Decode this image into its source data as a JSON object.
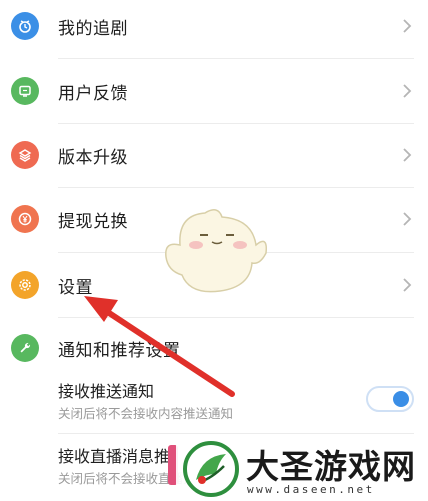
{
  "colors": {
    "blue": "#3b8fe6",
    "green": "#58b85f",
    "red": "#ef6a52",
    "coral": "#f0744f",
    "orange": "#f3a42a",
    "arrow": "#e0302a",
    "toggle_on": "#3a8ee6"
  },
  "menu": [
    {
      "label": "我的追剧",
      "icon": "tv-icon"
    },
    {
      "label": "用户反馈",
      "icon": "feedback-icon"
    },
    {
      "label": "版本升级",
      "icon": "layers-icon"
    },
    {
      "label": "提现兑换",
      "icon": "yuan-icon"
    },
    {
      "label": "设置",
      "icon": "gear-icon"
    }
  ],
  "notifications": {
    "header": "通知和推荐设置",
    "push": {
      "title": "接收推送通知",
      "desc": "关闭后将不会接收内容推送通知",
      "enabled": true
    },
    "live": {
      "title": "接收直播消息推",
      "desc": "关闭后将不会接收直播推"
    }
  },
  "watermark": {
    "title": "大圣游戏网",
    "url": "www.daseen.net"
  }
}
